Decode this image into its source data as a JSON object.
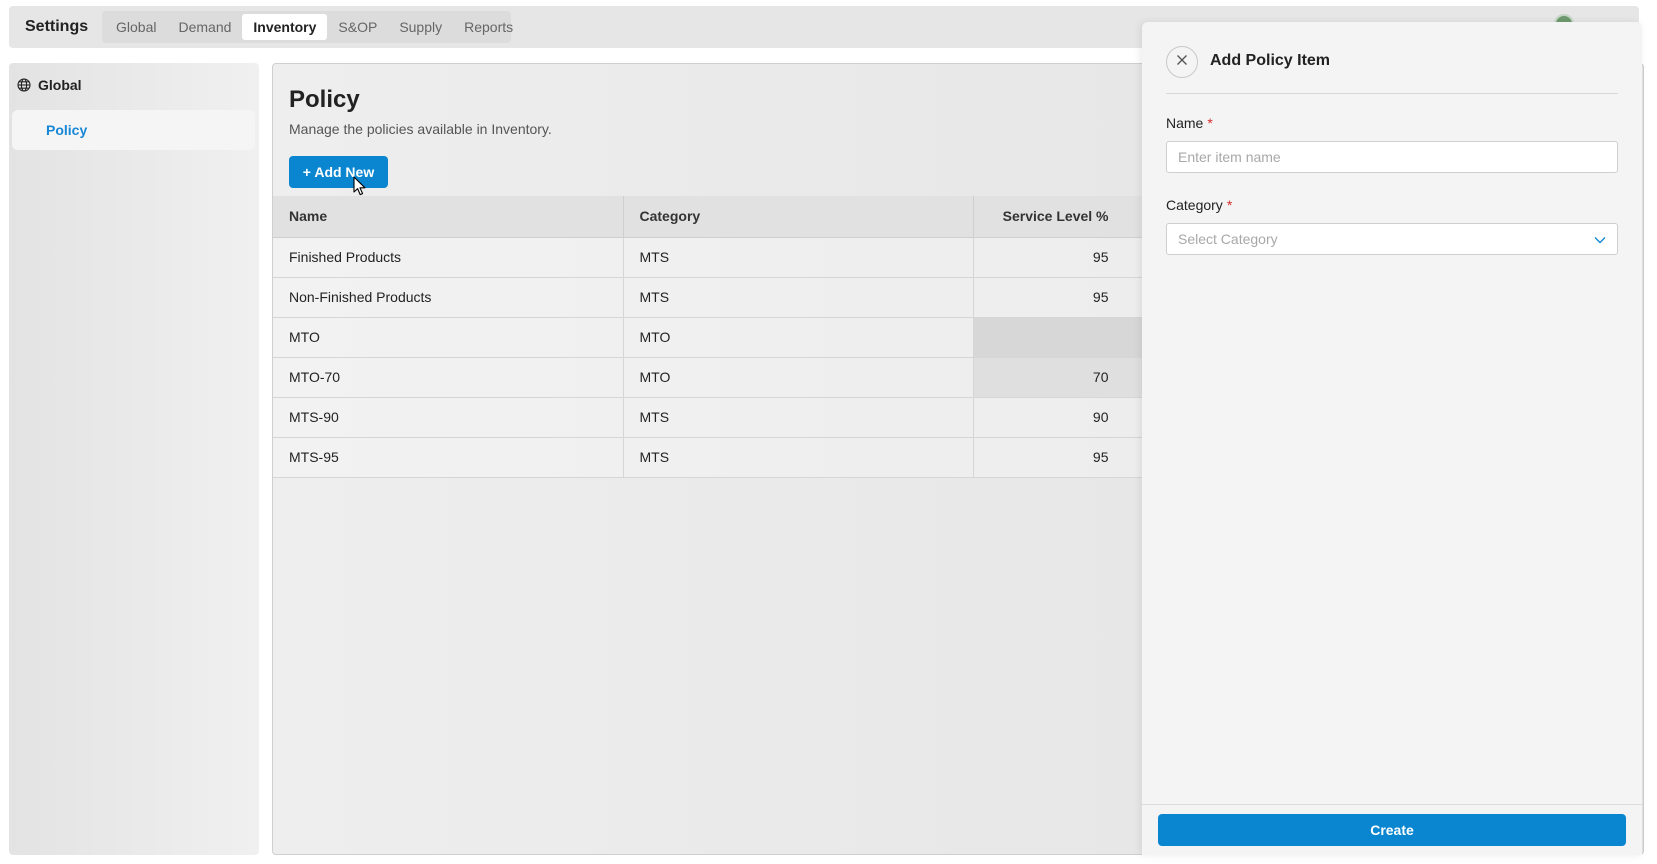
{
  "header": {
    "app_title": "Settings",
    "tabs": [
      {
        "label": "Global"
      },
      {
        "label": "Demand"
      },
      {
        "label": "Inventory",
        "active": true
      },
      {
        "label": "S&OP"
      },
      {
        "label": "Supply"
      },
      {
        "label": "Reports"
      }
    ]
  },
  "sidebar": {
    "group_label": "Global",
    "group_icon": "globe-icon",
    "items": [
      {
        "label": "Policy",
        "active": true
      }
    ]
  },
  "main": {
    "title": "Policy",
    "subtitle": "Manage the policies available in Inventory.",
    "add_button_label": "+ Add New",
    "table": {
      "columns": [
        "Name",
        "Category",
        "Service Level %"
      ],
      "rows": [
        [
          "Finished Products",
          "MTS",
          "95"
        ],
        [
          "Non-Finished Products",
          "MTS",
          "95"
        ],
        [
          "MTO",
          "MTO",
          ""
        ],
        [
          "MTO-70",
          "MTO",
          "70"
        ],
        [
          "MTS-90",
          "MTS",
          "90"
        ],
        [
          "MTS-95",
          "MTS",
          "95"
        ]
      ]
    }
  },
  "drawer": {
    "title": "Add Policy Item",
    "name_label": "Name",
    "name_placeholder": "Enter item name",
    "name_value": "",
    "category_label": "Category",
    "category_placeholder": "Select Category",
    "required_marker": "*",
    "create_label": "Create"
  },
  "colors": {
    "accent": "#0a86d0",
    "required": "#d42b2b",
    "nav_active_text": "#1787d6"
  }
}
